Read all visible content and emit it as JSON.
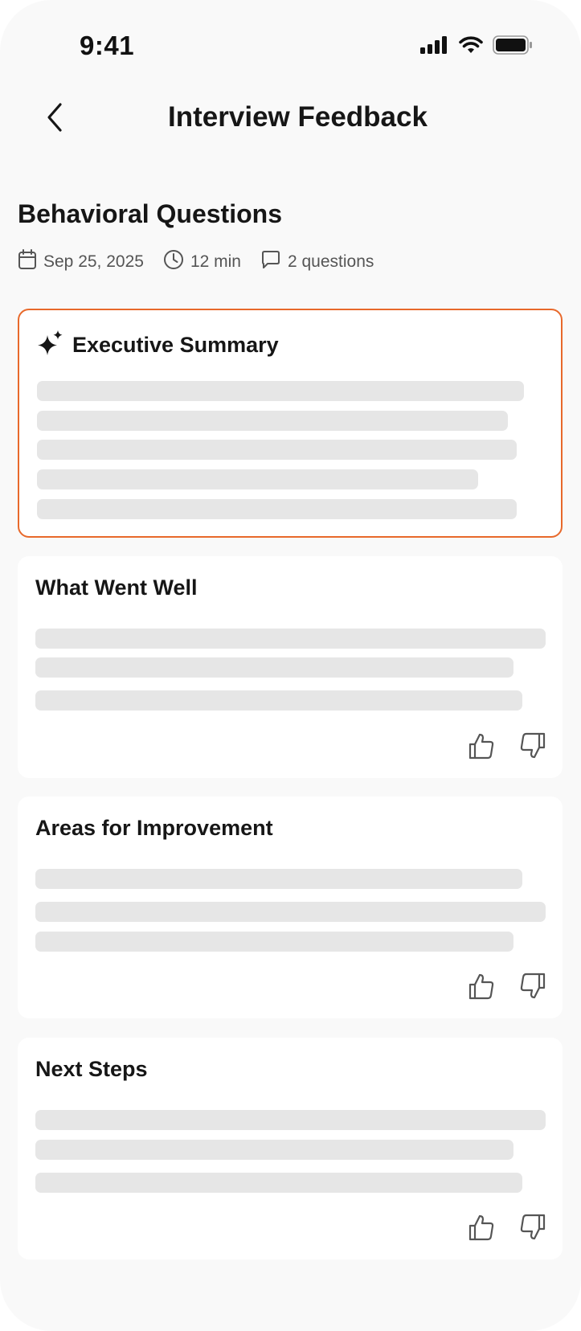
{
  "status_bar": {
    "time": "9:41",
    "icons": [
      "cellular-signal-icon",
      "wifi-icon",
      "battery-icon"
    ]
  },
  "header": {
    "title": "Interview Feedback",
    "back_icon": "chevron-left-icon"
  },
  "interview": {
    "title": "Behavioral Questions",
    "date": "Sep 25, 2025",
    "duration": "12 min",
    "questions": "2 questions"
  },
  "cards": {
    "summary": {
      "title": "Executive Summary",
      "icon": "sparkle-icon"
    },
    "went_well": {
      "title": "What Went Well"
    },
    "improvement": {
      "title": "Areas for Improvement"
    },
    "next_steps": {
      "title": "Next Steps"
    }
  },
  "colors": {
    "accent": "#e8692b",
    "background": "#f9f9f9",
    "card": "#ffffff",
    "skeleton": "#e6e6e6",
    "text": "#161616",
    "muted": "#555555"
  }
}
